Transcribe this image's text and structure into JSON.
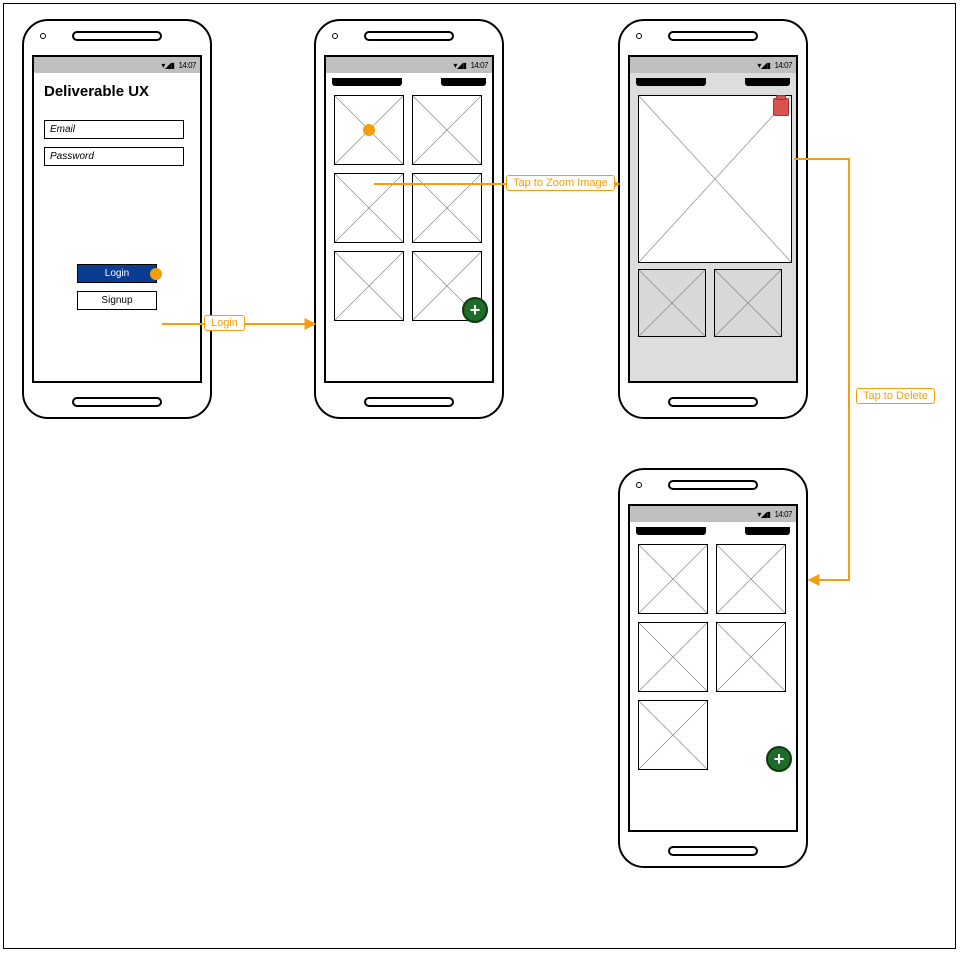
{
  "statusbar": {
    "time": "14:07",
    "icons": "▾◢▮"
  },
  "screen_login": {
    "title": "Deliverable UX",
    "email_placeholder": "Email",
    "password_placeholder": "Password",
    "login_label": "Login",
    "signup_label": "Signup"
  },
  "flow": {
    "login_label": "Login",
    "zoom_label": "Tap to Zoom Image",
    "delete_label": "Tap to Delete"
  }
}
